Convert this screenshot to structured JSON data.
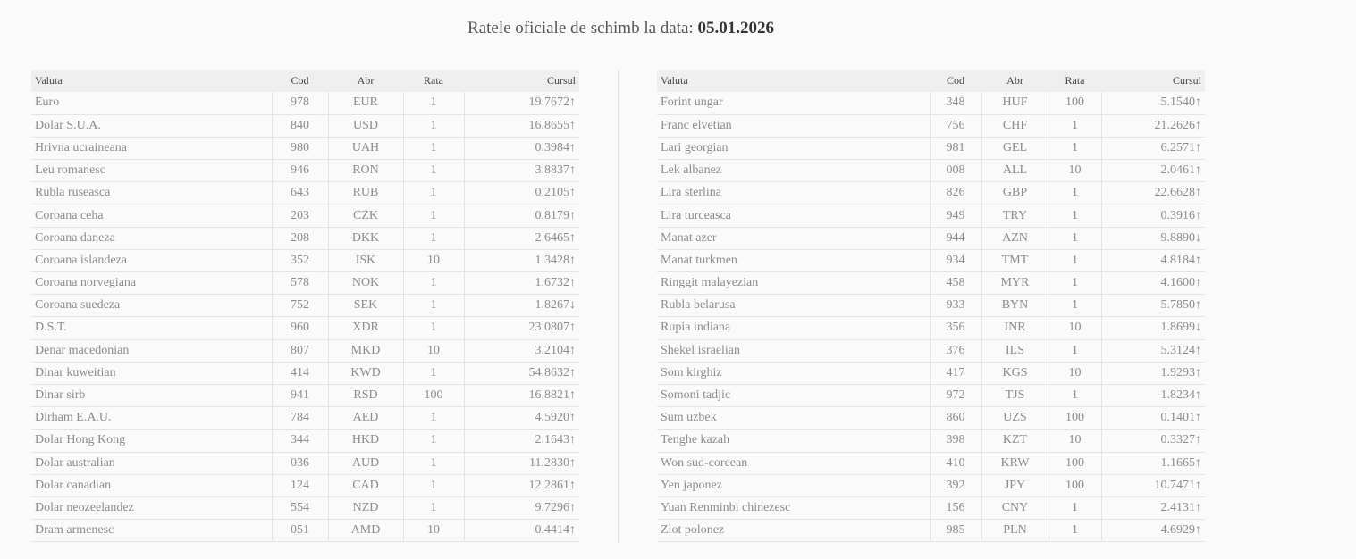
{
  "title": {
    "prefix": "Ratele oficiale de schimb la data: ",
    "date": "05.01.2026"
  },
  "headers": {
    "valuta": "Valuta",
    "cod": "Cod",
    "abr": "Abr",
    "rata": "Rata",
    "cursul": "Cursul"
  },
  "colors": {
    "up": "#3aa872",
    "down": "#d9391e"
  },
  "left_table": [
    {
      "valuta": "Euro",
      "cod": "978",
      "abr": "EUR",
      "rata": "1",
      "cursul": "19.7672↑",
      "trend": "up"
    },
    {
      "valuta": "Dolar S.U.A.",
      "cod": "840",
      "abr": "USD",
      "rata": "1",
      "cursul": "16.8655↑",
      "trend": "up"
    },
    {
      "valuta": "Hrivna ucraineana",
      "cod": "980",
      "abr": "UAH",
      "rata": "1",
      "cursul": "0.3984↑",
      "trend": "up"
    },
    {
      "valuta": "Leu romanesc",
      "cod": "946",
      "abr": "RON",
      "rata": "1",
      "cursul": "3.8837↑",
      "trend": "up"
    },
    {
      "valuta": "Rubla ruseasca",
      "cod": "643",
      "abr": "RUB",
      "rata": "1",
      "cursul": "0.2105↑",
      "trend": "up"
    },
    {
      "valuta": "Coroana ceha",
      "cod": "203",
      "abr": "CZK",
      "rata": "1",
      "cursul": "0.8179↑",
      "trend": "up"
    },
    {
      "valuta": "Coroana daneza",
      "cod": "208",
      "abr": "DKK",
      "rata": "1",
      "cursul": "2.6465↑",
      "trend": "up"
    },
    {
      "valuta": "Coroana islandeza",
      "cod": "352",
      "abr": "ISK",
      "rata": "10",
      "cursul": "1.3428↑",
      "trend": "up"
    },
    {
      "valuta": "Coroana norvegiana",
      "cod": "578",
      "abr": "NOK",
      "rata": "1",
      "cursul": "1.6732↑",
      "trend": "up"
    },
    {
      "valuta": "Coroana suedeza",
      "cod": "752",
      "abr": "SEK",
      "rata": "1",
      "cursul": "1.8267↓",
      "trend": "down"
    },
    {
      "valuta": "D.S.T.",
      "cod": "960",
      "abr": "XDR",
      "rata": "1",
      "cursul": "23.0807↑",
      "trend": "up"
    },
    {
      "valuta": "Denar macedonian",
      "cod": "807",
      "abr": "MKD",
      "rata": "10",
      "cursul": "3.2104↑",
      "trend": "up"
    },
    {
      "valuta": "Dinar kuweitian",
      "cod": "414",
      "abr": "KWD",
      "rata": "1",
      "cursul": "54.8632↑",
      "trend": "up"
    },
    {
      "valuta": "Dinar sirb",
      "cod": "941",
      "abr": "RSD",
      "rata": "100",
      "cursul": "16.8821↑",
      "trend": "up"
    },
    {
      "valuta": "Dirham E.A.U.",
      "cod": "784",
      "abr": "AED",
      "rata": "1",
      "cursul": "4.5920↑",
      "trend": "up"
    },
    {
      "valuta": "Dolar Hong Kong",
      "cod": "344",
      "abr": "HKD",
      "rata": "1",
      "cursul": "2.1643↑",
      "trend": "up"
    },
    {
      "valuta": "Dolar australian",
      "cod": "036",
      "abr": "AUD",
      "rata": "1",
      "cursul": "11.2830↑",
      "trend": "up"
    },
    {
      "valuta": "Dolar canadian",
      "cod": "124",
      "abr": "CAD",
      "rata": "1",
      "cursul": "12.2861↑",
      "trend": "up"
    },
    {
      "valuta": "Dolar neozeelandez",
      "cod": "554",
      "abr": "NZD",
      "rata": "1",
      "cursul": "9.7296↑",
      "trend": "up"
    },
    {
      "valuta": "Dram armenesc",
      "cod": "051",
      "abr": "AMD",
      "rata": "10",
      "cursul": "0.4414↑",
      "trend": "up"
    }
  ],
  "right_table": [
    {
      "valuta": "Forint ungar",
      "cod": "348",
      "abr": "HUF",
      "rata": "100",
      "cursul": "5.1540↑",
      "trend": "up"
    },
    {
      "valuta": "Franc elvetian",
      "cod": "756",
      "abr": "CHF",
      "rata": "1",
      "cursul": "21.2626↑",
      "trend": "up"
    },
    {
      "valuta": "Lari georgian",
      "cod": "981",
      "abr": "GEL",
      "rata": "1",
      "cursul": "6.2571↑",
      "trend": "up"
    },
    {
      "valuta": "Lek albanez",
      "cod": "008",
      "abr": "ALL",
      "rata": "10",
      "cursul": "2.0461↑",
      "trend": "up"
    },
    {
      "valuta": "Lira sterlina",
      "cod": "826",
      "abr": "GBP",
      "rata": "1",
      "cursul": "22.6628↑",
      "trend": "up"
    },
    {
      "valuta": "Lira turceasca",
      "cod": "949",
      "abr": "TRY",
      "rata": "1",
      "cursul": "0.3916↑",
      "trend": "up"
    },
    {
      "valuta": "Manat azer",
      "cod": "944",
      "abr": "AZN",
      "rata": "1",
      "cursul": "9.8890↓",
      "trend": "down"
    },
    {
      "valuta": "Manat turkmen",
      "cod": "934",
      "abr": "TMT",
      "rata": "1",
      "cursul": "4.8184↑",
      "trend": "up"
    },
    {
      "valuta": "Ringgit malayezian",
      "cod": "458",
      "abr": "MYR",
      "rata": "1",
      "cursul": "4.1600↑",
      "trend": "up"
    },
    {
      "valuta": "Rubla belarusa",
      "cod": "933",
      "abr": "BYN",
      "rata": "1",
      "cursul": "5.7850↑",
      "trend": "up"
    },
    {
      "valuta": "Rupia indiana",
      "cod": "356",
      "abr": "INR",
      "rata": "10",
      "cursul": "1.8699↓",
      "trend": "down"
    },
    {
      "valuta": "Shekel israelian",
      "cod": "376",
      "abr": "ILS",
      "rata": "1",
      "cursul": "5.3124↑",
      "trend": "up"
    },
    {
      "valuta": "Som kirghiz",
      "cod": "417",
      "abr": "KGS",
      "rata": "10",
      "cursul": "1.9293↑",
      "trend": "up"
    },
    {
      "valuta": "Somoni tadjic",
      "cod": "972",
      "abr": "TJS",
      "rata": "1",
      "cursul": "1.8234↑",
      "trend": "up"
    },
    {
      "valuta": "Sum uzbek",
      "cod": "860",
      "abr": "UZS",
      "rata": "100",
      "cursul": "0.1401↑",
      "trend": "up"
    },
    {
      "valuta": "Tenghe kazah",
      "cod": "398",
      "abr": "KZT",
      "rata": "10",
      "cursul": "0.3327↑",
      "trend": "up"
    },
    {
      "valuta": "Won sud-coreean",
      "cod": "410",
      "abr": "KRW",
      "rata": "100",
      "cursul": "1.1665↑",
      "trend": "up"
    },
    {
      "valuta": "Yen japonez",
      "cod": "392",
      "abr": "JPY",
      "rata": "100",
      "cursul": "10.7471↑",
      "trend": "up"
    },
    {
      "valuta": "Yuan Renminbi chinezesc",
      "cod": "156",
      "abr": "CNY",
      "rata": "1",
      "cursul": "2.4131↑",
      "trend": "up"
    },
    {
      "valuta": "Zlot polonez",
      "cod": "985",
      "abr": "PLN",
      "rata": "1",
      "cursul": "4.6929↑",
      "trend": "up"
    }
  ]
}
